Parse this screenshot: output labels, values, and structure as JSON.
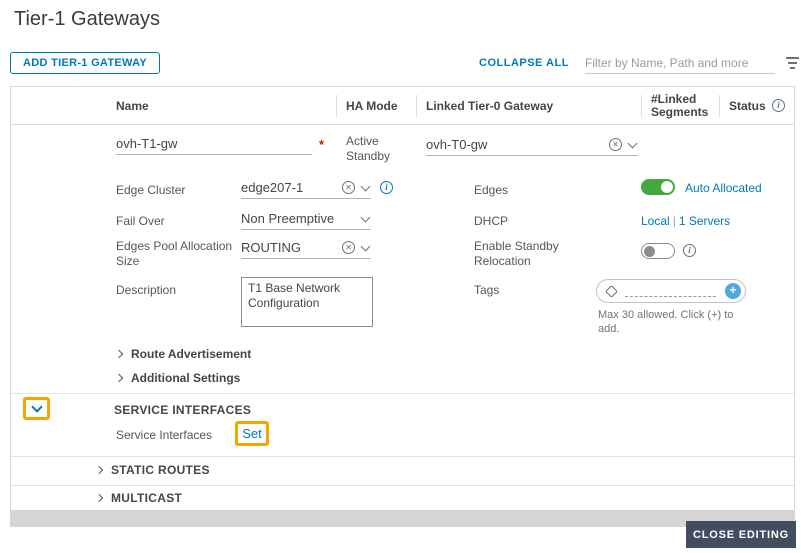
{
  "page": {
    "title": "Tier-1 Gateways"
  },
  "toolbar": {
    "add_button": "ADD TIER-1 GATEWAY",
    "collapse_all": "COLLAPSE ALL",
    "filter_placeholder": "Filter by Name, Path and more"
  },
  "table": {
    "columns": [
      "Name",
      "HA Mode",
      "Linked Tier-0 Gateway",
      "#Linked Segments",
      "Status"
    ]
  },
  "gateway": {
    "name": "ovh-T1-gw",
    "required_marker": "*",
    "ha_mode": "Active Standby",
    "linked_t0": "ovh-T0-gw"
  },
  "fields": {
    "edge_cluster": {
      "label": "Edge Cluster",
      "value": "edge207-1"
    },
    "fail_over": {
      "label": "Fail Over",
      "value": "Non Preemptive"
    },
    "pool_size": {
      "label": "Edges Pool Allocation Size",
      "value": "ROUTING"
    },
    "description": {
      "label": "Description",
      "value": "T1 Base Network Configuration"
    },
    "edges": {
      "label": "Edges",
      "value": "Auto Allocated"
    },
    "dhcp": {
      "label": "DHCP",
      "local": "Local",
      "divider": "|",
      "servers": "1 Servers"
    },
    "standby": {
      "label": "Enable Standby Relocation"
    },
    "tags": {
      "label": "Tags",
      "help": "Max 30 allowed. Click (+) to add."
    }
  },
  "sections": {
    "route_advertisement": "Route Advertisement",
    "additional_settings": "Additional Settings",
    "service_interfaces_header": "SERVICE INTERFACES",
    "service_interfaces_label": "Service Interfaces",
    "set_link": "Set",
    "static_routes": "STATIC ROUTES",
    "multicast": "MULTICAST"
  },
  "footer": {
    "close_editing": "CLOSE EDITING"
  },
  "icons": {
    "info": "i",
    "clear": "✕",
    "plus": "+"
  },
  "colors": {
    "accent": "#0079B8",
    "toggle_on": "#42A83F",
    "highlight_box": "#F7A400",
    "close_button_bg": "#424D5F",
    "required": "#C92100"
  }
}
